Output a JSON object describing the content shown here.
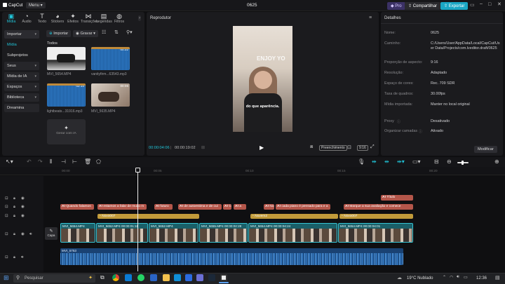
{
  "app": {
    "name": "CapCut",
    "menu_label": "Menu",
    "project_title": "0625",
    "pro_label": "Pro",
    "share_label": "Compartilhar",
    "export_label": "Exportar"
  },
  "toolbar": {
    "tabs": [
      {
        "label": "Mídia",
        "icon": "media-icon"
      },
      {
        "label": "Áudio",
        "icon": "audio-icon"
      },
      {
        "label": "Texto",
        "icon": "text-icon"
      },
      {
        "label": "Stickers",
        "icon": "sticker-icon"
      },
      {
        "label": "Efeitos",
        "icon": "effects-icon"
      },
      {
        "label": "Transições",
        "icon": "transitions-icon"
      },
      {
        "label": "Legendas",
        "icon": "captions-icon"
      },
      {
        "label": "Filtros",
        "icon": "filters-icon"
      }
    ]
  },
  "left_nav": {
    "import_label": "Importar",
    "items": [
      {
        "label": "Mídia"
      },
      {
        "label": "Subprojetos"
      },
      {
        "label": "Seus"
      },
      {
        "label": "Mídia de IA"
      },
      {
        "label": "Espaços"
      },
      {
        "label": "Biblioteca"
      },
      {
        "label": "Dreamina"
      }
    ]
  },
  "media": {
    "import_button": "Importar",
    "record_button": "Gravar",
    "section_label": "Todos",
    "items": [
      {
        "name": "MVI_5654.MP4",
        "duration": ""
      },
      {
        "name": "vanityfirm...63543.mp3",
        "duration": "00:22"
      },
      {
        "name": "lightbeats...31916.mp3",
        "duration": "02:14"
      },
      {
        "name": "MVI_5635.MP4",
        "duration": "00:06"
      }
    ],
    "ai_label": "Gerar com IA"
  },
  "player": {
    "title": "Reprodutor",
    "current_time": "00:00:04:06",
    "total_time": "00:00:19:02",
    "ratio_label": "Preenchimento",
    "ratio_value": "9:16",
    "caption_text": "do que aparência.",
    "video_text": "ENJOY YO"
  },
  "details": {
    "title": "Detalhes",
    "rows": [
      {
        "label": "Nome:",
        "value": "0625"
      },
      {
        "label": "Caminho:",
        "value": "C:/Users/User/AppData/Local/CapCut/User Data/Projects/com.lveditor.draft/0625"
      },
      {
        "label": "Proporção de aspecto:",
        "value": "9:16"
      },
      {
        "label": "Resolução:",
        "value": "Adaptado"
      },
      {
        "label": "Espaço de cores:",
        "value": "Rec. 709 SDR"
      },
      {
        "label": "Taxa de quadros:",
        "value": "30.00fps"
      },
      {
        "label": "Mídia importada:",
        "value": "Manter no local original"
      },
      {
        "label": "Proxy",
        "value": "Desativado"
      },
      {
        "label": "Organizar camadas",
        "value": "Ativado"
      }
    ],
    "modify_button": "Modificar"
  },
  "timeline": {
    "ruler": [
      "00:00",
      "00:05",
      "00:10",
      "00:15",
      "00:20"
    ],
    "title_clip": "Título",
    "text_clips": [
      "Quando falamos",
      "estamos a falar de muito m",
      "futuro",
      "de autoestima e de cui",
      "Cd",
      "a",
      "No",
      "cada piano é pensado para e a",
      "Marque a sua avaliação e comece"
    ],
    "sticker_clips": [
      "Novo007",
      "Nuvem2",
      "Novo007"
    ],
    "video_clips": [
      {
        "name": "MVI_5654.MP4",
        "duration": "00:00:01:11"
      },
      {
        "name": "MVI_5652.MP4",
        "duration": "00:00:02:28"
      },
      {
        "name": "MVI_5655.MP4",
        "duration": "00:00:02:14"
      },
      {
        "name": "MVI_5654.MP4",
        "duration": "00:00:04:24"
      },
      {
        "name": "MVI_5654.MP4",
        "duration": "00:00:04:01"
      }
    ],
    "cover_label": "Capa",
    "audio_clip": "MVI_5753"
  },
  "taskbar": {
    "search_placeholder": "Pesquisar",
    "weather": "19°C Nublado",
    "time": "12:36"
  },
  "colors": {
    "accent": "#21c4d8",
    "export": "#1aa7c4",
    "text_clip": "#b4564a",
    "sticker": "#c29b3a",
    "video_clip": "#1e6f79",
    "audio": "#1e4f86"
  }
}
